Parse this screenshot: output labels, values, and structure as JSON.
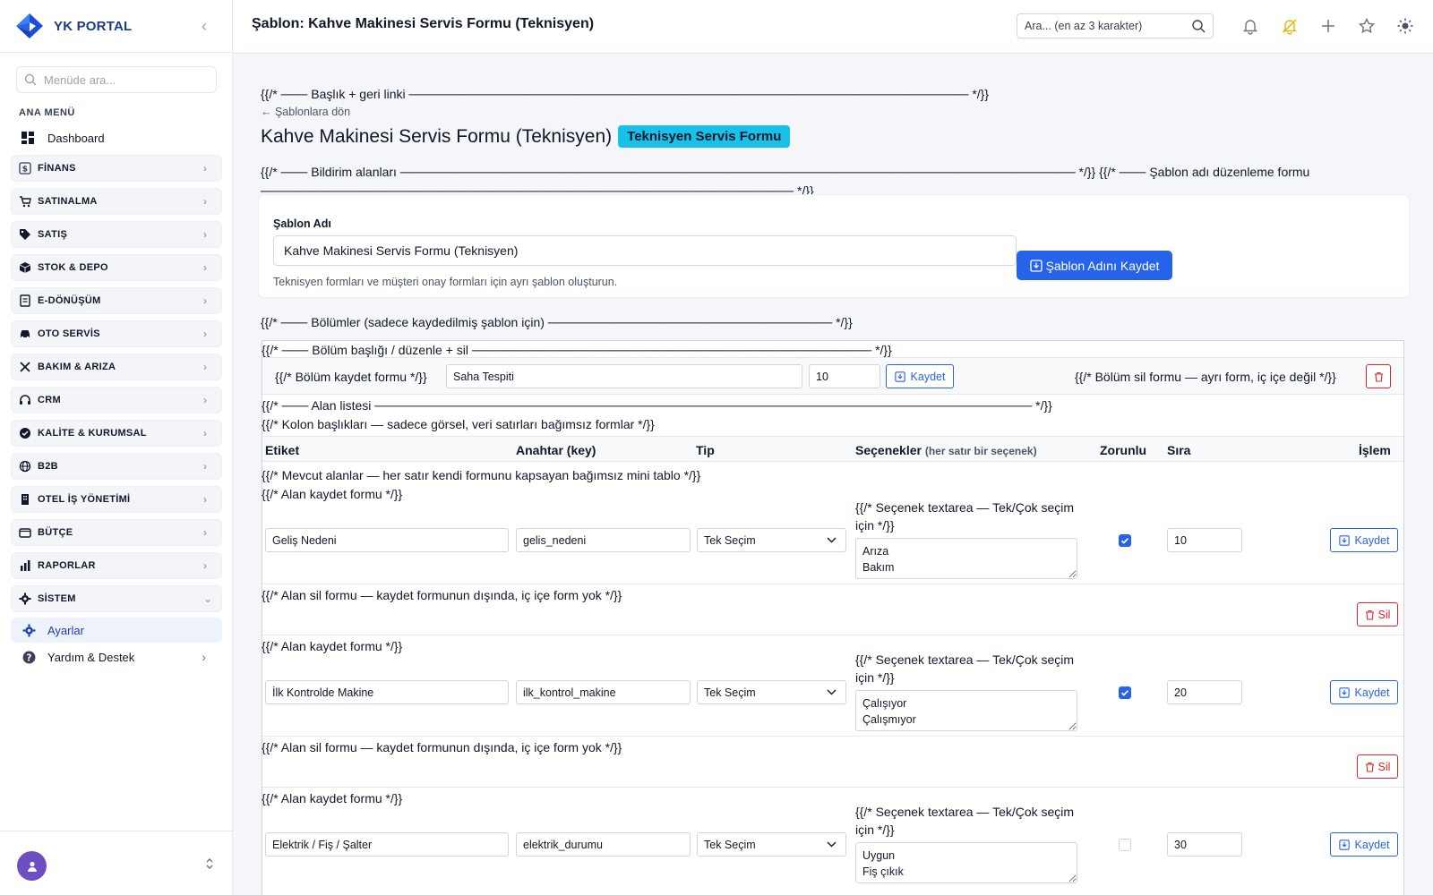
{
  "brand": {
    "name": "YK PORTAL"
  },
  "sidebar": {
    "search_placeholder": "Menüde ara...",
    "section_label": "ANA MENÜ",
    "dashboard": "Dashboard",
    "groups": [
      {
        "label": "FİNANS",
        "icon": "finance-icon"
      },
      {
        "label": "SATINALMA",
        "icon": "cart-icon"
      },
      {
        "label": "SATIŞ",
        "icon": "tag-icon"
      },
      {
        "label": "STOK & DEPO",
        "icon": "box-icon"
      },
      {
        "label": "E-DÖNÜŞÜM",
        "icon": "document-icon"
      },
      {
        "label": "OTO SERVİS",
        "icon": "car-icon"
      },
      {
        "label": "BAKIM & ARIZA",
        "icon": "tools-icon"
      },
      {
        "label": "CRM",
        "icon": "headset-icon"
      },
      {
        "label": "KALİTE & KURUMSAL",
        "icon": "badge-check-icon"
      },
      {
        "label": "B2B",
        "icon": "globe-icon"
      },
      {
        "label": "OTEL İŞ YÖNETİMİ",
        "icon": "building-icon"
      },
      {
        "label": "BÜTÇE",
        "icon": "wallet-icon"
      },
      {
        "label": "RAPORLAR",
        "icon": "bar-chart-icon"
      },
      {
        "label": "SİSTEM",
        "icon": "gear-icon",
        "expanded": true
      }
    ],
    "active_item": "Ayarlar",
    "help_item": "Yardım & Destek"
  },
  "header": {
    "title": "Şablon: Kahve Makinesi Servis Formu (Teknisyen)",
    "search_placeholder": "Ara... (en az 3 karakter)"
  },
  "main": {
    "c_title": "{{/* ─── Başlık + geri linki ─────────────────────────────────────────────────────────────── */}}",
    "back_link": "← Şablonlara dön",
    "heading": "Kahve Makinesi Servis Formu (Teknisyen)",
    "badge": "Teknisyen Servis Formu",
    "c_notify_1": "{{/* ─── Bildirim alanları ──────────────────────────────────────────────────────────────────────────── */}} {{/* ─── Şablon adı düzenleme formu",
    "c_notify_2": "──────────────────────────────────────────────────────────── */}}",
    "name_card": {
      "label": "Şablon Adı",
      "value": "Kahve Makinesi Servis Formu (Teknisyen)",
      "hint": "Teknisyen formları ve müşteri onay formları için ayrı şablon oluşturun.",
      "save_label": "Şablon Adını Kaydet"
    },
    "c_sections": "{{/* ─── Bölümler (sadece kaydedilmiş şablon için) ──────────────────────────────── */}}",
    "c_section_head": "{{/* ─── Bölüm başlığı / düzenle + sil ───────────────────────────────────────────── */}}",
    "section": {
      "c_save_form": "{{/* Bölüm kaydet formu */}}",
      "title_value": "Saha Tespiti",
      "order_value": "10",
      "save_label": "Kaydet",
      "c_delete_form": "{{/* Bölüm sil formu — ayrı form, iç içe değil */}}"
    },
    "c_field_list": "{{/* ─── Alan listesi ────────────────────────────────────────────────────────────────────────── */}}",
    "c_col_headers": "{{/* Kolon başlıkları — sadece görsel, veri satırları bağımsız formlar */}}",
    "columns": {
      "label": "Etiket",
      "key": "Anahtar (key)",
      "type": "Tip",
      "options": "Seçenekler",
      "options_sub": "(her satır bir seçenek)",
      "required": "Zorunlu",
      "order": "Sıra",
      "action": "İşlem"
    },
    "c_existing": "{{/* Mevcut alanlar — her satır kendi formunu kapsayan bağımsız mini tablo */}}",
    "c_field_save": "{{/* Alan kaydet formu */}}",
    "c_textarea": "{{/* Seçenek textarea — Tek/Çok seçim için */}}",
    "c_field_delete": "{{/* Alan sil formu — kaydet formunun dışında, iç içe form yok */}}",
    "save_label": "Kaydet",
    "delete_label": "Sil",
    "fields": [
      {
        "label": "Geliş Nedeni",
        "key": "gelis_nedeni",
        "type": "Tek Seçim",
        "options": "Arıza\nBakım",
        "required": true,
        "order": "10"
      },
      {
        "label": "İlk Kontrolde Makine",
        "key": "ilk_kontrol_makine",
        "type": "Tek Seçim",
        "options": "Çalışıyor\nÇalışmıyor",
        "required": true,
        "order": "20"
      },
      {
        "label": "Elektrik / Fiş / Şalter",
        "key": "elektrik_durumu",
        "type": "Tek Seçim",
        "options": "Uygun\nFiş çıkık",
        "required": false,
        "order": "30"
      }
    ]
  },
  "colors": {
    "primary": "#2563eb",
    "badge": "#17c1e8",
    "danger": "#dc2626",
    "avatar": "#6d4fc2"
  }
}
